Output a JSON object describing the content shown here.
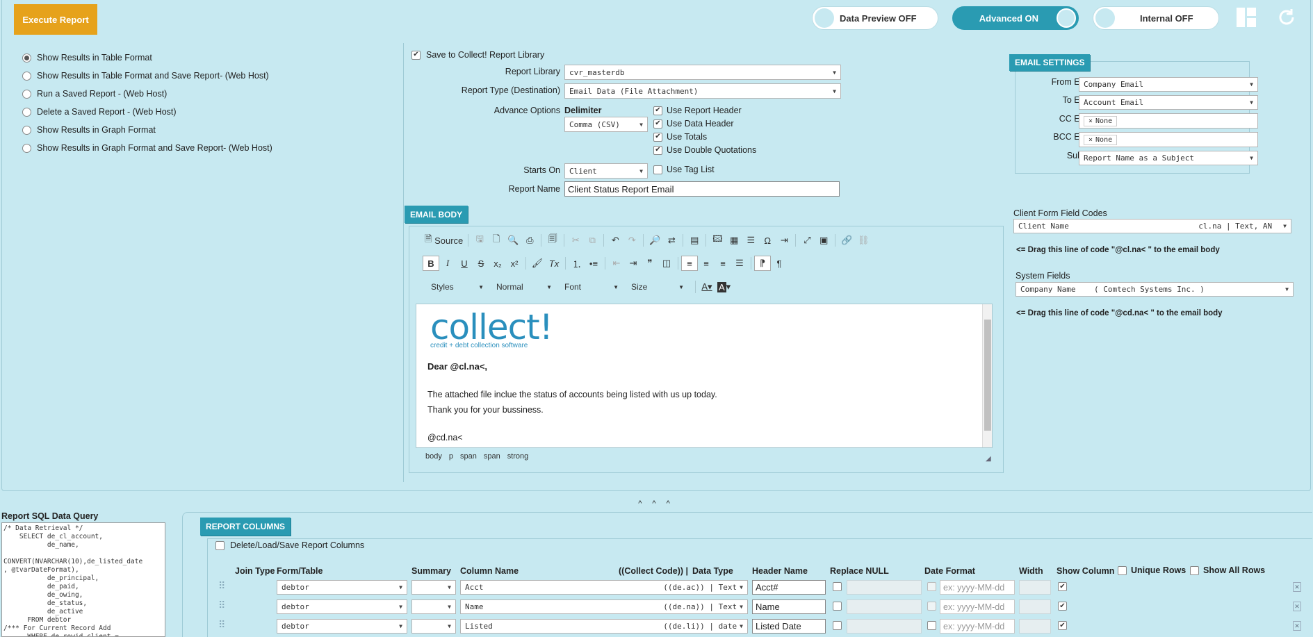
{
  "header": {
    "execute_label": "Execute Report",
    "toggles": [
      {
        "label": "Data Preview OFF",
        "on": false
      },
      {
        "label": "Advanced ON",
        "on": true
      },
      {
        "label": "Internal OFF",
        "on": false
      }
    ]
  },
  "output_options": [
    {
      "label": "Show Results in Table Format",
      "selected": true
    },
    {
      "label": "Show Results in Table Format and Save Report- (Web Host)",
      "selected": false
    },
    {
      "label": "Run a Saved Report - (Web Host)",
      "selected": false
    },
    {
      "label": "Delete a Saved Report - (Web Host)",
      "selected": false
    },
    {
      "label": "Show Results in Graph Format",
      "selected": false
    },
    {
      "label": "Show Results in Graph Format and Save Report- (Web Host)",
      "selected": false
    }
  ],
  "report_form": {
    "save_to_library_label": "Save to Collect! Report Library",
    "report_library_label": "Report Library",
    "report_library_value": "cvr_masterdb",
    "report_type_label": "Report Type (Destination)",
    "report_type_value": "Email Data (File Attachment)",
    "advance_options_label": "Advance Options",
    "delimiter_label": "Delimiter",
    "delimiter_value": "Comma (CSV)",
    "checks": {
      "report_header": "Use Report Header",
      "data_header": "Use Data Header",
      "totals": "Use Totals",
      "double_quotes": "Use Double Quotations",
      "tag_list": "Use Tag List"
    },
    "starts_on_label": "Starts On",
    "starts_on_value": "Client",
    "report_name_label": "Report Name",
    "report_name_value": "Client Status Report Email"
  },
  "email_settings": {
    "title": "EMAIL SETTINGS",
    "from_label": "From Email:",
    "from_value": "Company Email",
    "to_label": "To Email:",
    "to_value": "Account Email",
    "cc_label": "CC Email:",
    "cc_tag": "None",
    "bcc_label": "BCC Email:",
    "bcc_tag": "None",
    "subject_label": "Subject:",
    "subject_value": "Report Name as a Subject"
  },
  "field_codes": {
    "client_form_label": "Client Form Field Codes",
    "client_form_value": "Client Name",
    "client_form_code": "cl.na | Text, AN",
    "client_hint": "<= Drag this line of code \"@cl.na< \" to the email body",
    "system_fields_label": "System Fields",
    "system_fields_value": "Company Name    ( Comtech Systems Inc. )",
    "system_hint": "<= Drag this line of code \"@cd.na< \" to the email body"
  },
  "email_body": {
    "title": "EMAIL BODY",
    "source_label": "Source",
    "styles_label": "Styles",
    "format_label": "Normal",
    "font_label": "Font",
    "size_label": "Size",
    "logo_text": "collect!",
    "logo_tagline": "credit + debt collection software",
    "greeting": "Dear @cl.na<,",
    "line1": "The attached file inclue the status of accounts being listed with us up today.",
    "line2": "Thank you for your bussiness.",
    "signature": "@cd.na<",
    "path": [
      "body",
      "p",
      "span",
      "span",
      "strong"
    ]
  },
  "sql": {
    "title": "Report SQL Data Query",
    "text": "/* Data Retrieval */\n    SELECT de_cl_account,\n           de_name,\n\nCONVERT(NVARCHAR(10),de_listed_date\n, @tvarDateFormat),\n           de_principal,\n           de_paid,\n           de_owing,\n           de_status,\n           de_active\n      FROM debtor\n/*** For Current Record Add\n      WHERE de_rowid_client ="
  },
  "report_columns": {
    "title": "REPORT COLUMNS",
    "delete_load_label": "Delete/Load/Save Report Columns",
    "headers": {
      "join_type": "Join Type",
      "form_table": "Form/Table",
      "summary": "Summary",
      "column_name": "Column Name",
      "collect_code": "((Collect Code)) |",
      "data_type": "Data Type",
      "header_name": "Header Name",
      "replace_null": "Replace NULL",
      "date_format": "Date Format",
      "width": "Width",
      "show_column": "Show Column",
      "unique_rows": "Unique Rows",
      "show_all_rows": "Show All Rows"
    },
    "date_placeholder": "ex: yyyy-MM-dd",
    "rows": [
      {
        "table": "debtor",
        "column": "Acct",
        "code": "((de.ac)) | Text",
        "header": "Acct#"
      },
      {
        "table": "debtor",
        "column": "Name",
        "code": "((de.na)) | Text",
        "header": "Name"
      },
      {
        "table": "debtor",
        "column": "Listed",
        "code": "((de.li)) | date",
        "header": "Listed Date"
      }
    ]
  },
  "splitter_label": "^ ^ ^"
}
